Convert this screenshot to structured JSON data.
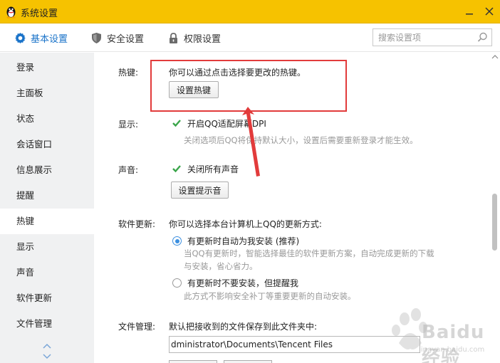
{
  "window": {
    "title": "系统设置"
  },
  "tabs": [
    {
      "label": "基本设置",
      "icon": "gear-icon",
      "active": true
    },
    {
      "label": "安全设置",
      "icon": "shield-icon",
      "active": false
    },
    {
      "label": "权限设置",
      "icon": "lock-icon",
      "active": false
    }
  ],
  "search": {
    "placeholder": "搜索设置项"
  },
  "sidebar": {
    "items": [
      {
        "label": "登录"
      },
      {
        "label": "主面板"
      },
      {
        "label": "状态"
      },
      {
        "label": "会话窗口"
      },
      {
        "label": "信息展示"
      },
      {
        "label": "提醒"
      },
      {
        "label": "热键",
        "active": true
      },
      {
        "label": "显示"
      },
      {
        "label": "声音"
      },
      {
        "label": "软件更新"
      },
      {
        "label": "文件管理"
      }
    ]
  },
  "hotkey": {
    "label": "热键:",
    "description": "你可以通过点击选择要更改的热键。",
    "button": "设置热键"
  },
  "display": {
    "label": "显示:",
    "checkbox": "开启QQ适配屏幕DPI",
    "checked": true,
    "hint": "关闭选项后QQ将保持默认大小，设置后需要重新登录才能生效。"
  },
  "sound": {
    "label": "声音:",
    "checkbox": "关闭所有声音",
    "checked": true,
    "button": "设置提示音"
  },
  "update": {
    "label": "软件更新:",
    "description": "你可以选择本台计算机上QQ的更新方式:",
    "option1": "有更新时自动为我安装 (推荐)",
    "option1_hint_line1": "当QQ有更新时，智能选择最佳的软件更新方案，自动完成更新的下载",
    "option1_hint_line2": "与安装，省心省力。",
    "option2": "有更新时不要安装，但提醒我",
    "option2_hint": "此方式不影响安全补丁等重要更新的自动安装。",
    "selected": 1
  },
  "files": {
    "label": "文件管理:",
    "description": "默认把接收到的文件保存到此文件夹中:",
    "path": "dministrator\\Documents\\Tencent Files"
  },
  "colors": {
    "titlebar": "#f6c200",
    "accent": "#1a73c9",
    "highlight": "#e23b3b",
    "check": "#3aa54a"
  },
  "watermark": {
    "text": "Baidu 经验",
    "url": "jingyan.baidu.com"
  }
}
